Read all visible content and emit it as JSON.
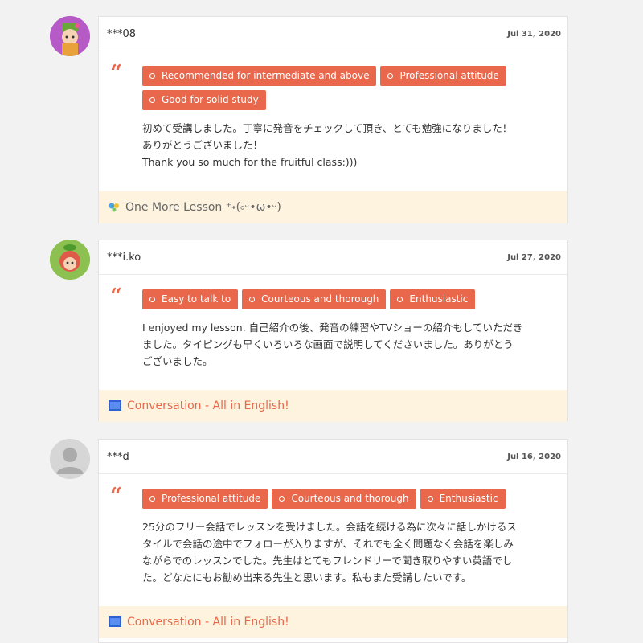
{
  "reviews": [
    {
      "username": "***08",
      "date": "Jul 31, 2020",
      "avatar_icon": "girl-with-green-hat-avatar",
      "tags": [
        "Recommended for intermediate and above",
        "Professional attitude",
        "Good for solid study"
      ],
      "comment_lines": [
        "初めて受講しました。丁寧に発音をチェックして頂き、とても勉強になりました！",
        "ありがとうございました！",
        "Thank you so much for the fruitful class:)))"
      ],
      "course_icon": "colored-dots-icon",
      "course": "One More Lesson ⁺˖(৹ᵕ•ω•ᵕ)",
      "course_color": "#666666"
    },
    {
      "username": "***i.ko",
      "date": "Jul 27, 2020",
      "avatar_icon": "apple-character-avatar",
      "tags": [
        "Easy to talk to",
        "Courteous and thorough",
        "Enthusiastic"
      ],
      "comment_lines": [
        "I enjoyed my lesson. 自己紹介の後、発音の練習やTVショーの紹介もしていただき",
        "ました。タイピングも早くいろいろな画面で説明してくださいました。ありがとう",
        "ございました。"
      ],
      "course_icon": "monitor-icon",
      "course": "Conversation - All in English!",
      "course_color": "#e9674a"
    },
    {
      "username": "***d",
      "date": "Jul 16, 2020",
      "avatar_icon": "default-user-avatar",
      "tags": [
        "Professional attitude",
        "Courteous and thorough",
        "Enthusiastic"
      ],
      "comment_lines": [
        "25分のフリー会話でレッスンを受けました。会話を続ける為に次々に話しかけるス",
        "タイルで会話の途中でフォローが入りますが、それでも全く問題なく会話を楽しみ",
        "ながらでのレッスンでした。先生はとてもフレンドリーで聞き取りやすい英語でし",
        "た。どなたにもお勧め出来る先生と思います。私もまた受講したいです。"
      ],
      "course_icon": "monitor-icon",
      "course": "Conversation - All in English!",
      "course_color": "#e9674a"
    }
  ],
  "colors": {
    "accent": "#e9674a",
    "course_bg": "#fdf3df",
    "page_bg": "#f2f2f2"
  }
}
